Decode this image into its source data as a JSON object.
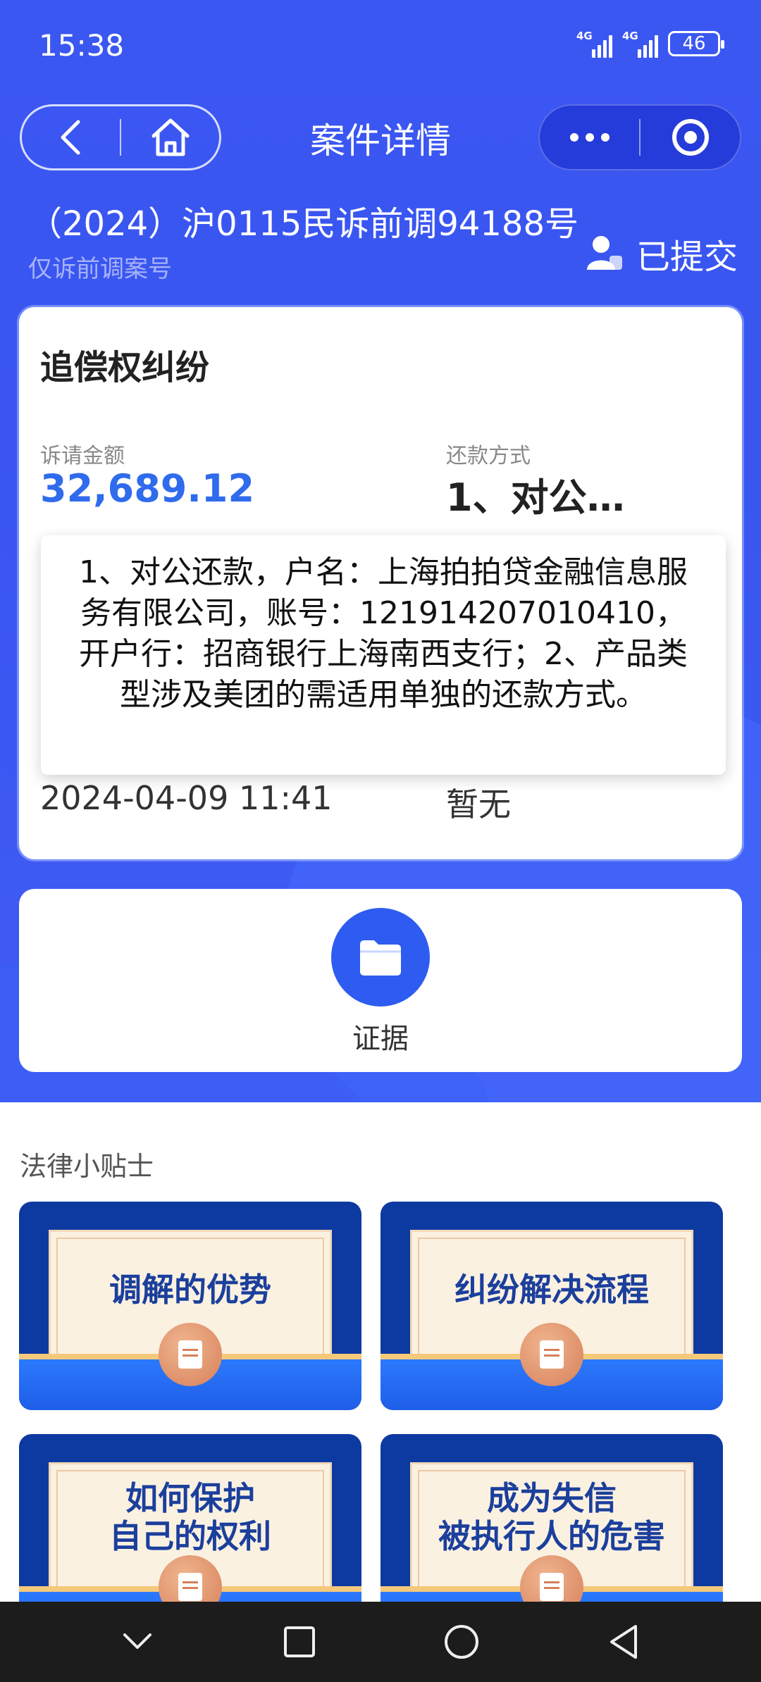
{
  "status_bar": {
    "time": "15:38",
    "signal1_label": "4G",
    "signal2_label": "4G",
    "battery": "46"
  },
  "nav": {
    "title": "案件详情",
    "back_icon": "chevron-left-icon",
    "home_icon": "home-icon",
    "more_icon": "more-dots-icon",
    "target_icon": "record-target-icon"
  },
  "case": {
    "number": "（2024）沪0115民诉前调94188号",
    "subtitle": "仅诉前调案号",
    "status": "已提交",
    "status_icon": "user-icon"
  },
  "detail": {
    "title": "追偿权纠纷",
    "amount_label": "诉请金额",
    "amount": "32,689.12",
    "method_label": "还款方式",
    "method": "1、对公…",
    "date": "2024-04-09 11:41",
    "second_value": "暂无",
    "tooltip": "1、对公还款，户名：上海拍拍贷金融信息服务有限公司，账号：121914207010410，开户行：招商银行上海南西支行；2、产品类型涉及美团的需适用单独的还款方式。"
  },
  "evidence": {
    "label": "证据",
    "icon": "folder-icon"
  },
  "tips": {
    "title": "法律小贴士",
    "items": [
      {
        "line1": "调解的优势",
        "line2": ""
      },
      {
        "line1": "纠纷解决流程",
        "line2": ""
      },
      {
        "line1": "如何保护",
        "line2": "自己的权利"
      },
      {
        "line1": "成为失信",
        "line2": "被执行人的危害"
      }
    ]
  },
  "colors": {
    "brand_blue": "#3b57f2",
    "amount_blue": "#2f6bec",
    "tip_title_blue": "#1b3f9c"
  },
  "system_nav": {
    "back": "back-triangle-icon",
    "home": "home-circle-icon",
    "recents": "recents-square-icon",
    "collapse": "chevron-down-icon"
  }
}
